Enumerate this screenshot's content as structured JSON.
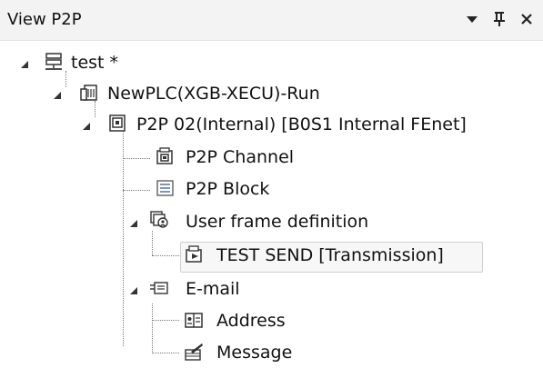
{
  "window": {
    "title": "View P2P",
    "buttons": [
      {
        "name": "dropdown-button",
        "icon": "triangle-down-icon"
      },
      {
        "name": "pin-button",
        "icon": "pin-icon"
      },
      {
        "name": "close-button",
        "icon": "close-icon"
      }
    ]
  },
  "tree": {
    "items": [
      {
        "label": "test *",
        "icon": "project-icon",
        "expanded": true,
        "level": 0
      },
      {
        "label": "NewPLC(XGB-XECU)-Run",
        "icon": "plc-icon",
        "expanded": true,
        "level": 1
      },
      {
        "label": "P2P 02(Internal) [B0S1 Internal FEnet]",
        "icon": "p2p-module-icon",
        "expanded": true,
        "level": 2
      },
      {
        "label": "P2P Channel",
        "icon": "channel-icon",
        "level": 3
      },
      {
        "label": "P2P Block",
        "icon": "block-icon",
        "level": 3
      },
      {
        "label": "User frame definition",
        "icon": "user-frame-icon",
        "expanded": true,
        "level": 3
      },
      {
        "label": "TEST SEND [Transmission]",
        "icon": "frame-send-icon",
        "level": 4,
        "selected": true
      },
      {
        "label": "E-mail",
        "icon": "email-icon",
        "expanded": true,
        "level": 3
      },
      {
        "label": "Address",
        "icon": "address-book-icon",
        "level": 4
      },
      {
        "label": "Message",
        "icon": "message-icon",
        "level": 4
      }
    ]
  },
  "colors": {
    "titlebar_bg": "#f3f3f3",
    "selection_border": "#cfcfcf",
    "text": "#111111"
  }
}
